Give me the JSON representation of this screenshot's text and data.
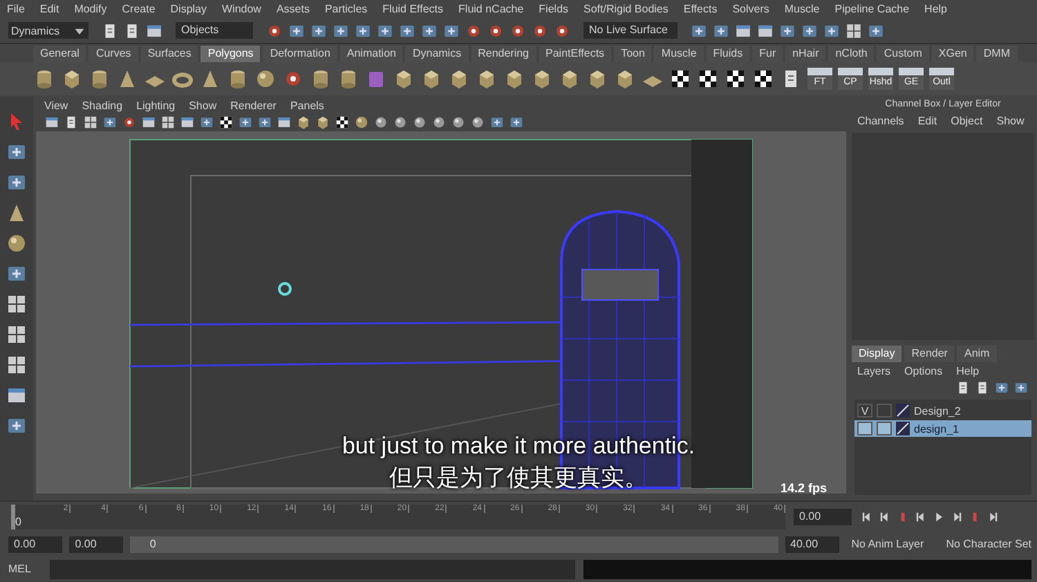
{
  "menu_bar": [
    "File",
    "Edit",
    "Modify",
    "Create",
    "Display",
    "Window",
    "Assets",
    "Particles",
    "Fluid Effects",
    "Fluid nCache",
    "Fields",
    "Soft/Rigid Bodies",
    "Effects",
    "Solvers",
    "Muscle",
    "Pipeline Cache",
    "Help"
  ],
  "status_line": {
    "mode": "Dynamics",
    "selection_field": "Objects",
    "live_surface": "No Live Surface"
  },
  "shelf": {
    "tabs": [
      {
        "label": "General",
        "selected": false
      },
      {
        "label": "Curves",
        "selected": false
      },
      {
        "label": "Surfaces",
        "selected": false
      },
      {
        "label": "Polygons",
        "selected": true
      },
      {
        "label": "Deformation",
        "selected": false
      },
      {
        "label": "Animation",
        "selected": false
      },
      {
        "label": "Dynamics",
        "selected": false
      },
      {
        "label": "Rendering",
        "selected": false
      },
      {
        "label": "PaintEffects",
        "selected": false
      },
      {
        "label": "Toon",
        "selected": false
      },
      {
        "label": "Muscle",
        "selected": false
      },
      {
        "label": "Fluids",
        "selected": false
      },
      {
        "label": "Fur",
        "selected": false
      },
      {
        "label": "nHair",
        "selected": false
      },
      {
        "label": "nCloth",
        "selected": false
      },
      {
        "label": "Custom",
        "selected": false
      },
      {
        "label": "XGen",
        "selected": false
      },
      {
        "label": "DMM",
        "selected": false
      }
    ],
    "labeled_tools": [
      "FT",
      "CP",
      "Hshd",
      "GE",
      "Outl"
    ]
  },
  "panel_menu": [
    "View",
    "Shading",
    "Lighting",
    "Show",
    "Renderer",
    "Panels"
  ],
  "viewport": {
    "fps": "14.2 fps"
  },
  "subtitles": [
    "but just to make it more authentic.",
    "但只是为了使其更真实。"
  ],
  "channel_box": {
    "title": "Channel Box / Layer Editor",
    "menu": [
      "Channels",
      "Edit",
      "Object",
      "Show"
    ]
  },
  "layer_editor": {
    "tabs": [
      {
        "label": "Display",
        "selected": true
      },
      {
        "label": "Render",
        "selected": false
      },
      {
        "label": "Anim",
        "selected": false
      }
    ],
    "menu": [
      "Layers",
      "Options",
      "Help"
    ],
    "layers": [
      {
        "name": "Design_2",
        "visibility": "V",
        "selected": false
      },
      {
        "name": "design_1",
        "selected": true
      }
    ]
  },
  "time_slider": {
    "ticks": [
      "2",
      "4",
      "6",
      "8",
      "10",
      "12",
      "14",
      "16",
      "18",
      "20",
      "22",
      "24",
      "26",
      "28",
      "30",
      "32",
      "34",
      "36",
      "38",
      "40"
    ],
    "current_frame": "0",
    "current_time": "0.00",
    "level": 0
  },
  "range_slider": {
    "start_time": "0.00",
    "playback_start": "0.00",
    "range_start": "0",
    "range_end": "40.00",
    "anim_layer": "No Anim Layer",
    "character_set": "No Character Set",
    "level": 1
  },
  "command_line": {
    "language": "MEL"
  }
}
